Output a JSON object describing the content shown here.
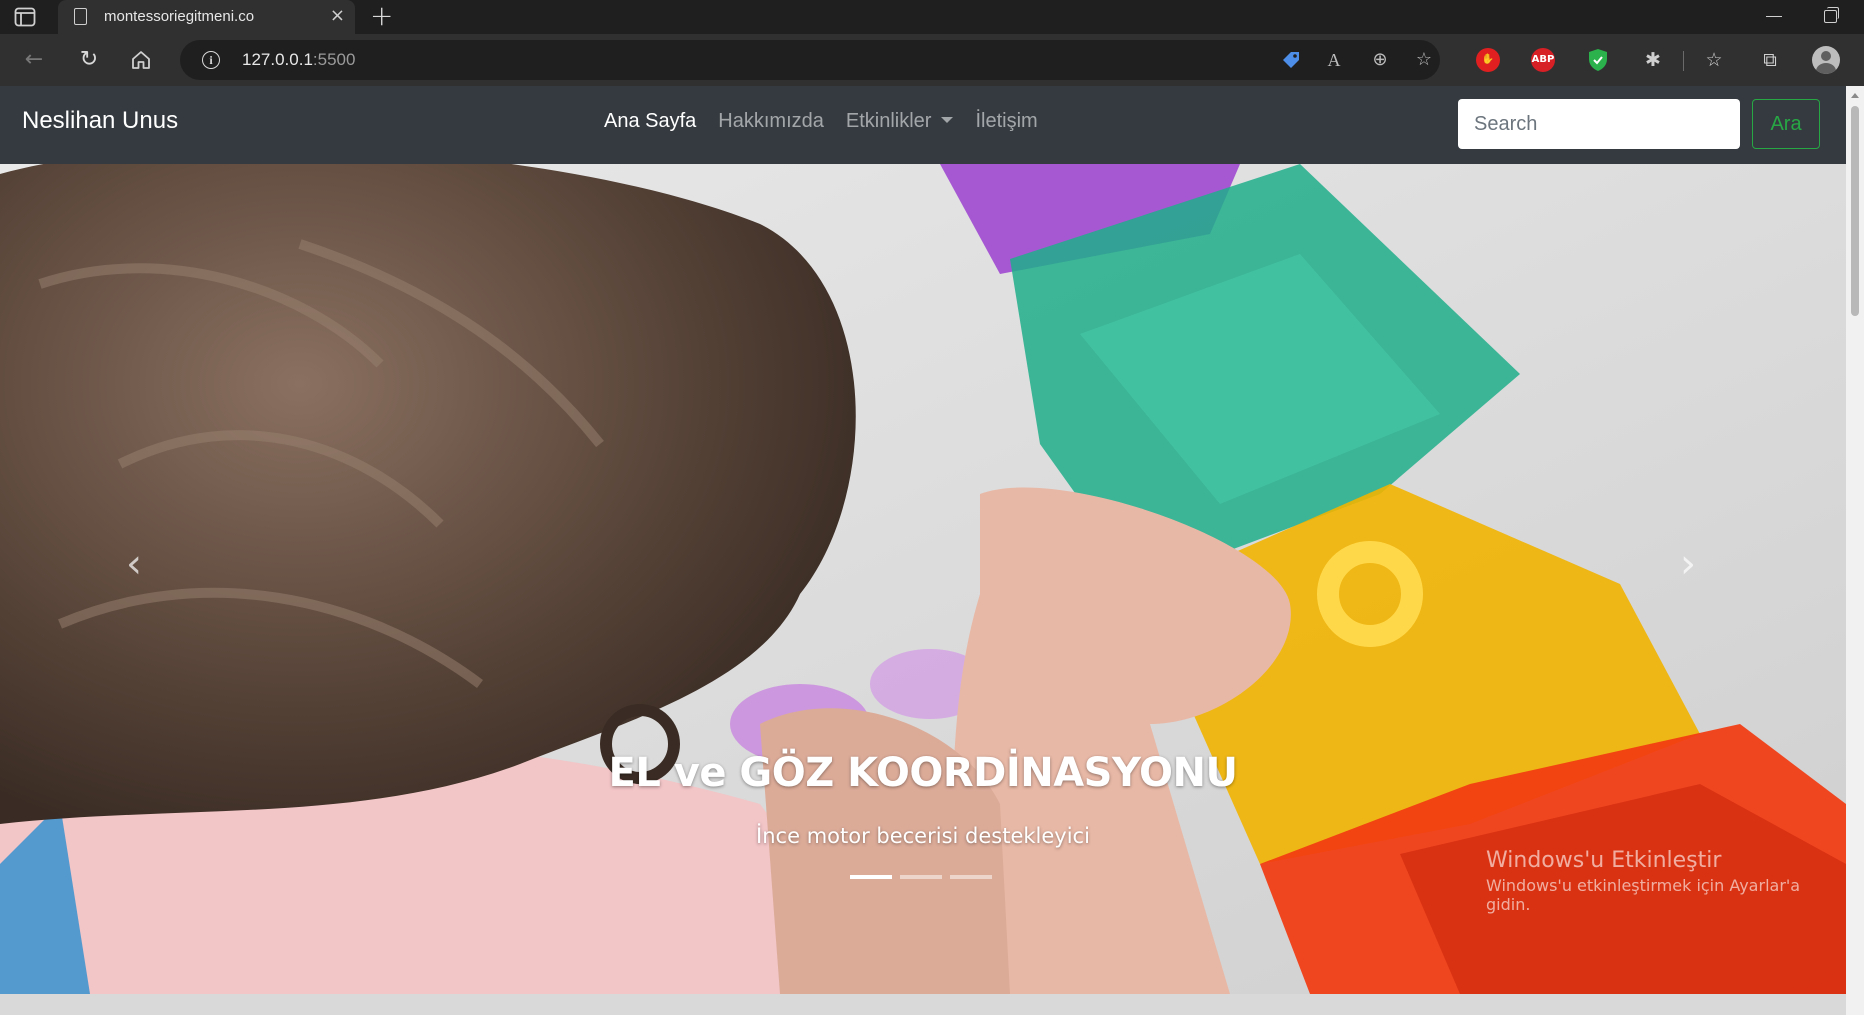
{
  "browser": {
    "tab_title": "montessoriegitmeni.co",
    "url_host": "127.0.0.1",
    "url_port": ":5500",
    "tab_close_glyph": "×",
    "new_tab_glyph": "+",
    "extension_abp_label": "ABP"
  },
  "navbar": {
    "brand": "Neslihan Unus",
    "links": [
      {
        "label": "Ana Sayfa",
        "active": true
      },
      {
        "label": "Hakkımızda",
        "active": false
      },
      {
        "label": "Etkinlikler",
        "active": false,
        "dropdown": true
      },
      {
        "label": "İletişim",
        "active": false
      }
    ],
    "search_placeholder": "Search",
    "search_button": "Ara",
    "colors": {
      "background": "#343a40",
      "search_button": "#28a745"
    }
  },
  "carousel": {
    "caption_title": "EL ve GÖZ KOORDİNASYONU",
    "caption_text": "İnce motor becerisi destekleyici",
    "slide_count": 3,
    "active_slide": 1,
    "prev_glyph": "‹",
    "next_glyph": "›"
  },
  "os_watermark": {
    "title": "Windows'u Etkinleştir",
    "subtitle": "Windows'u etkinleştirmek için Ayarlar'a gidin."
  }
}
